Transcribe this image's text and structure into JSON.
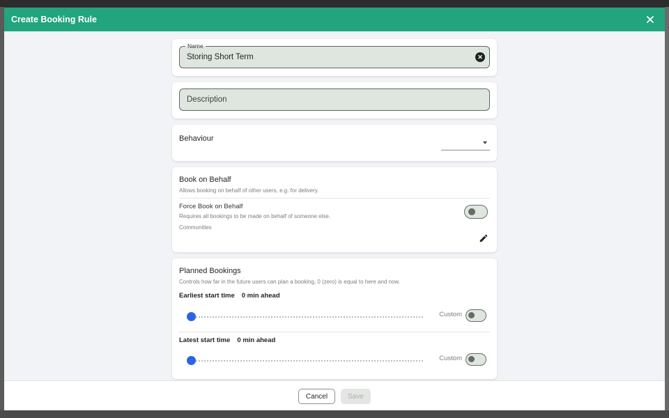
{
  "modal": {
    "title": "Create Booking Rule",
    "close_icon": "close-icon"
  },
  "name_field": {
    "legend": "Name",
    "value": "Storing Short Term"
  },
  "description_field": {
    "placeholder": "Description"
  },
  "behaviour": {
    "label": "Behaviour",
    "selected": ""
  },
  "book_on_behalf": {
    "title": "Book on Behalf",
    "subtitle": "Allows booking on behalf of other users, e.g. for delivery.",
    "force_label": "Force Book on Behalf",
    "force_sub": "Requires all bookings to be made on behalf of someone else.",
    "force_enabled": false,
    "communities_label": "Communities"
  },
  "planned_bookings": {
    "title": "Planned Bookings",
    "subtitle": "Controls how far in the future users can plan a booking, 0 (zero) is equal to here and now.",
    "earliest_label": "Earliest start time",
    "earliest_value": "0 min ahead",
    "earliest_slider": 0,
    "earliest_custom_label": "Custom",
    "earliest_custom": false,
    "latest_label": "Latest start time",
    "latest_value": "0 min ahead",
    "latest_slider": 0,
    "latest_custom_label": "Custom",
    "latest_custom": false
  },
  "footer": {
    "cancel_label": "Cancel",
    "save_label": "Save"
  },
  "colors": {
    "header": "#22a47e",
    "slider_thumb": "#2e63e7",
    "field_bg": "#dfe6df"
  }
}
